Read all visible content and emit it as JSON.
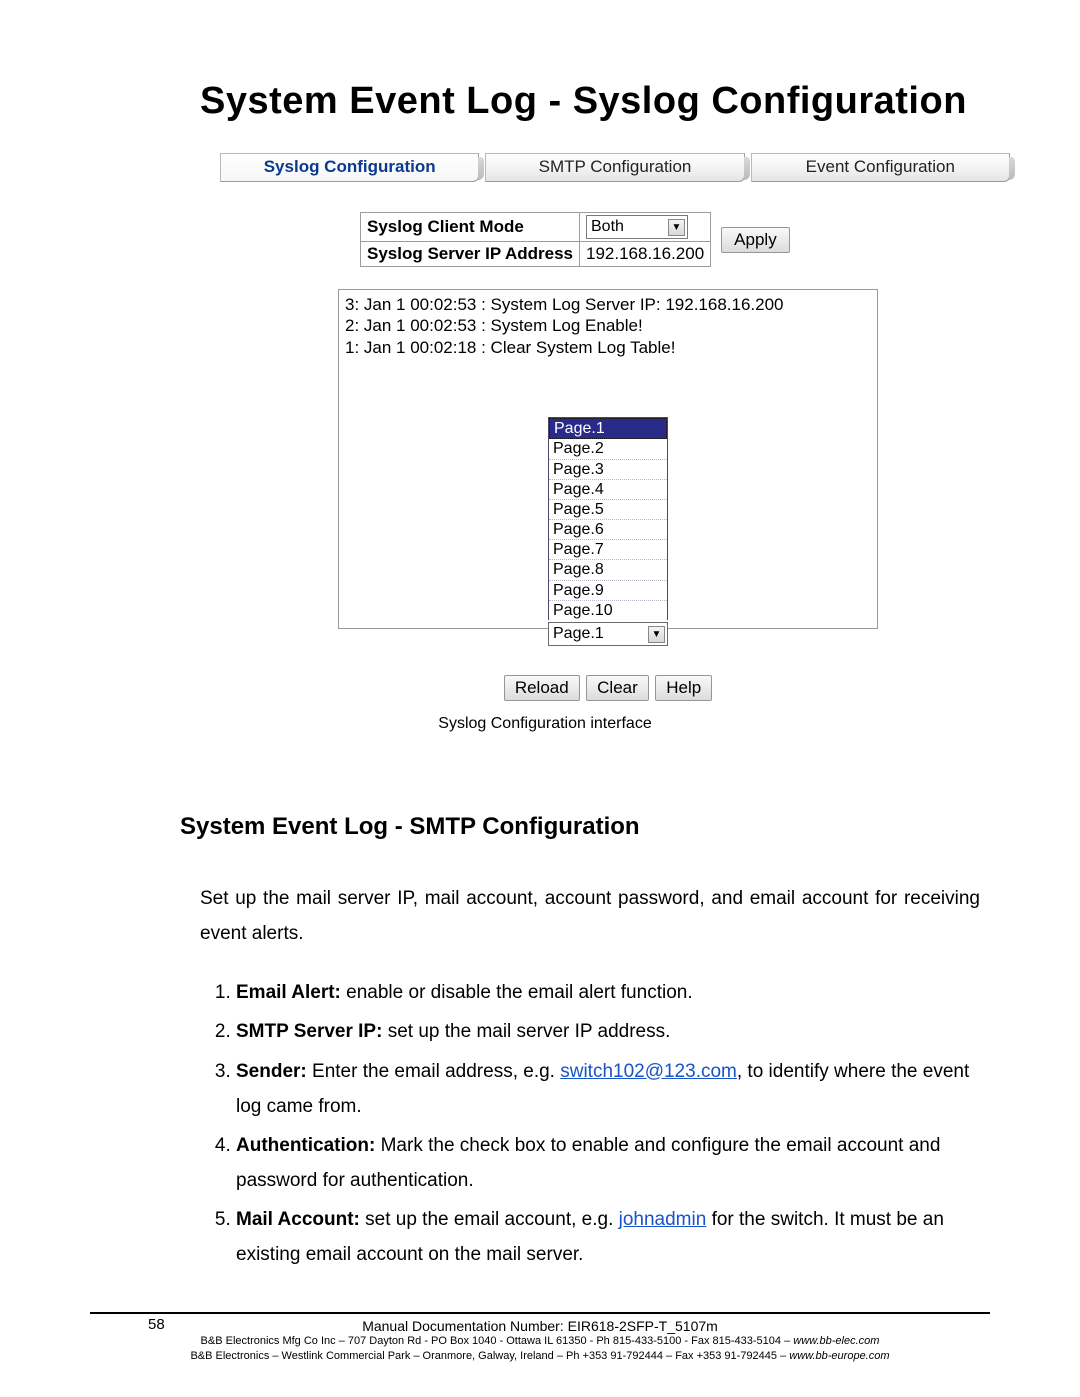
{
  "title": "System Event Log - Syslog Configuration",
  "tabs": {
    "syslog": "Syslog Configuration",
    "smtp": "SMTP Configuration",
    "event": "Event Configuration"
  },
  "config": {
    "mode_label": "Syslog Client Mode",
    "mode_value": "Both",
    "ip_label": "Syslog Server IP Address",
    "ip_value": "192.168.16.200",
    "apply": "Apply"
  },
  "log": {
    "lines": [
      "3: Jan 1 00:02:53 : System Log Server IP: 192.168.16.200",
      "2: Jan 1 00:02:53 : System Log Enable!",
      "1: Jan 1 00:02:18 : Clear System Log Table!"
    ]
  },
  "pages": {
    "list": [
      "Page.1",
      "Page.2",
      "Page.3",
      "Page.4",
      "Page.5",
      "Page.6",
      "Page.7",
      "Page.8",
      "Page.9",
      "Page.10"
    ],
    "selected": "Page.1"
  },
  "actions": {
    "reload": "Reload",
    "clear": "Clear",
    "help": "Help"
  },
  "caption": "Syslog Configuration interface",
  "smtp": {
    "heading": "System Event Log - SMTP Configuration",
    "intro": "Set up the mail server IP, mail account, account password, and email account for receiving event alerts.",
    "items": {
      "1": {
        "b": "Email Alert:",
        "t": " enable or disable the email alert function."
      },
      "2": {
        "b": "SMTP Server IP:",
        "t": " set up the mail server IP address."
      },
      "3": {
        "b": "Sender:",
        "t1": " Enter the email address, e.g. ",
        "link": "switch102@123.com",
        "t2": ", to identify where the event log came from."
      },
      "4": {
        "b": "Authentication:",
        "t": " Mark the check box to enable and configure the email account and password for authentication."
      },
      "5": {
        "b": "Mail Account:",
        "t1": " set up the email account, e.g. ",
        "link": "johnadmin",
        "t2": " for the switch. It must be an existing email account on the mail server."
      }
    }
  },
  "footer": {
    "page": "58",
    "doc": "Manual Documentation Number: EIR618-2SFP-T_5107m",
    "l1a": "B&B Electronics Mfg Co Inc – 707 Dayton Rd - PO Box 1040 - Ottawa IL 61350 - Ph 815-433-5100 - Fax 815-433-5104 – ",
    "l1b": "www.bb-elec.com",
    "l2a": "B&B Electronics – Westlink Commercial Park – Oranmore, Galway, Ireland – Ph +353 91-792444 – Fax +353 91-792445 – ",
    "l2b": "www.bb-europe.com"
  }
}
